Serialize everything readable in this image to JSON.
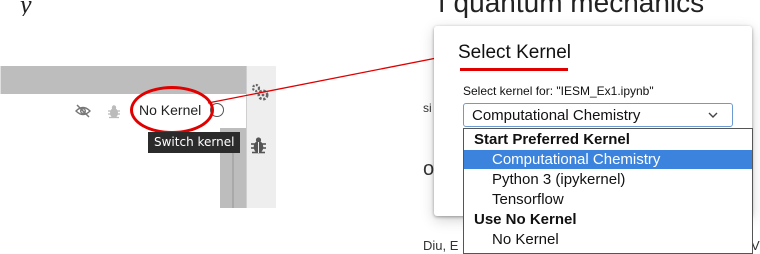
{
  "left_panel": {
    "kernel_name": "No Kernel",
    "tooltip": "Switch kernel",
    "icons": [
      "eye-off-icon",
      "bug-icon",
      "kernel-status-icon",
      "gear-icon",
      "bug-icon"
    ],
    "highlight_color": "#e00000"
  },
  "notebook_background": {
    "heading": "f quantum mechanics",
    "fragment_1": "si",
    "fragment_2": "o",
    "footer_left": "Diu, E",
    "footer_right": "V"
  },
  "dialog": {
    "title": "Select Kernel",
    "select_label": "Select kernel for: \"IESM_Ex1.ipynb\"",
    "selected_value": "Computational Chemistry",
    "options": [
      {
        "label": "Start Preferred Kernel",
        "type": "group"
      },
      {
        "label": "Computational Chemistry",
        "type": "item",
        "selected": true
      },
      {
        "label": "Python 3 (ipykernel)",
        "type": "item"
      },
      {
        "label": "Tensorflow",
        "type": "item"
      },
      {
        "label": "Use No Kernel",
        "type": "group"
      },
      {
        "label": "No Kernel",
        "type": "item"
      }
    ],
    "selected_color": "#3b83dd"
  }
}
